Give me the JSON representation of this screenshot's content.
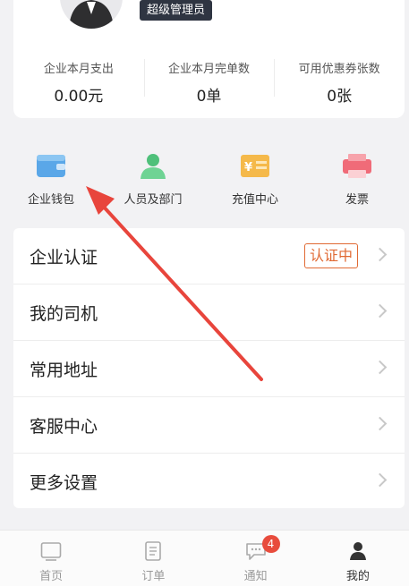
{
  "header": {
    "role_badge": "超级管理员"
  },
  "stats": [
    {
      "label": "企业本月支出",
      "value": "0.00元"
    },
    {
      "label": "企业本月完单数",
      "value": "0单"
    },
    {
      "label": "可用优惠券张数",
      "value": "0张"
    }
  ],
  "quick_entries": [
    {
      "label": "企业钱包",
      "icon": "wallet-icon"
    },
    {
      "label": "人员及部门",
      "icon": "people-icon"
    },
    {
      "label": "充值中心",
      "icon": "recharge-icon"
    },
    {
      "label": "发票",
      "icon": "invoice-icon"
    }
  ],
  "menu": [
    {
      "label": "企业认证",
      "badge": "认证中"
    },
    {
      "label": "我的司机"
    },
    {
      "label": "常用地址"
    },
    {
      "label": "客服中心"
    },
    {
      "label": "更多设置"
    }
  ],
  "tabbar": [
    {
      "label": "首页",
      "icon": "home-icon"
    },
    {
      "label": "订单",
      "icon": "order-icon"
    },
    {
      "label": "通知",
      "icon": "message-icon",
      "badge": "4"
    },
    {
      "label": "我的",
      "icon": "profile-icon",
      "active": true
    }
  ],
  "colors": {
    "accent_orange": "#e06a34",
    "badge_red": "#e84c3d",
    "annotation_red": "#e8453c"
  }
}
